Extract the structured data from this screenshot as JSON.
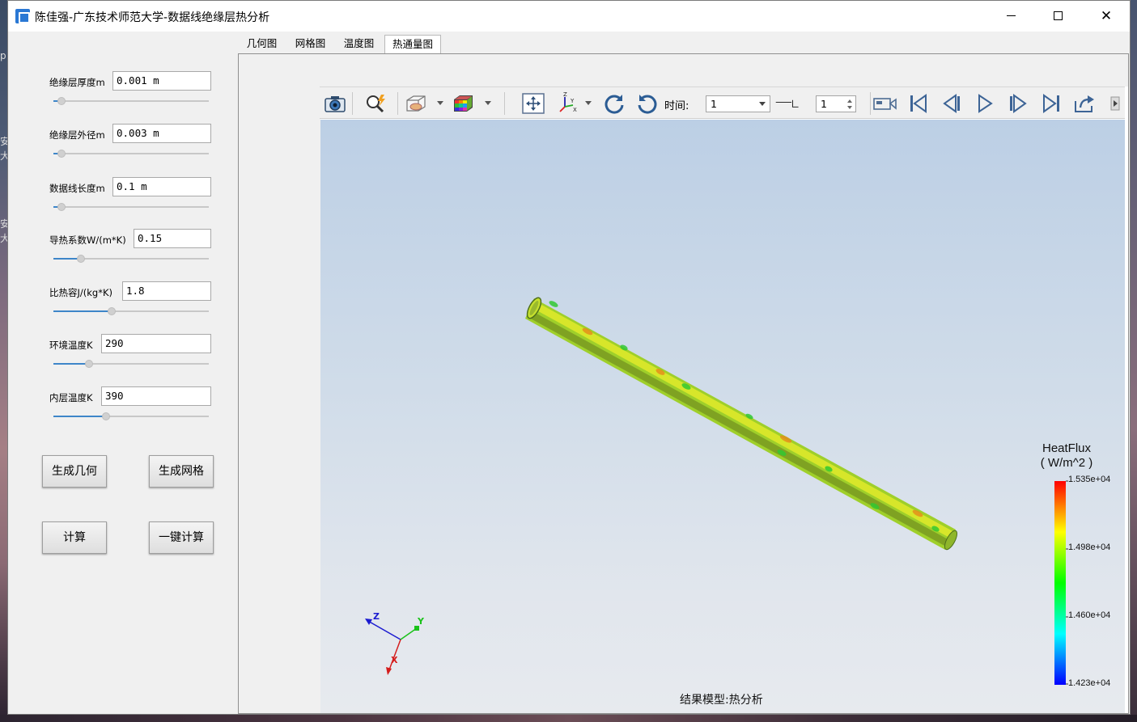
{
  "window": {
    "title": "陈佳强-广东技术师范大学-数据线绝缘层热分析"
  },
  "desktop_edge_chars": [
    "p",
    "安",
    "大",
    "安",
    "大"
  ],
  "params": [
    {
      "label": "绝缘层厚度m",
      "value": "0.001 m",
      "slider_fraction": 0.0
    },
    {
      "label": "绝缘层外径m",
      "value": "0.003 m",
      "slider_fraction": 0.0
    },
    {
      "label": "数据线长度m",
      "value": "0.1 m",
      "slider_fraction": 0.0
    },
    {
      "label": "导热系数W/(m*K)",
      "value": "0.15",
      "slider_fraction": 0.14
    },
    {
      "label": "比热容J/(kg*K)",
      "value": "1.8",
      "slider_fraction": 0.36
    },
    {
      "label": "环境温度K",
      "value": "290",
      "slider_fraction": 0.2
    },
    {
      "label": "内层温度K",
      "value": "390",
      "slider_fraction": 0.32
    }
  ],
  "buttons": {
    "gen_geometry": "生成几何",
    "gen_mesh": "生成网格",
    "compute": "计算",
    "one_click": "一键计算"
  },
  "tabs": [
    "几何图",
    "网格图",
    "温度图",
    "热通量图"
  ],
  "active_tab_index": 3,
  "toolbar": {
    "time_label": "时间:",
    "time_value": "1",
    "step_value": "1"
  },
  "result": {
    "model_label": "结果模型:热分析",
    "colorbar": {
      "title": "HeatFlux",
      "unit": "( W/m^2 )",
      "max_label": "1.535e+04",
      "ticks": [
        "1.535e+04",
        "1.498e+04",
        "1.460e+04",
        "1.423e+04"
      ],
      "colors": [
        "#ff0000",
        "#ffff00",
        "#00ff00",
        "#00ffff",
        "#0000ff"
      ]
    },
    "axes": {
      "x": "X",
      "y": "Y",
      "z": "Z"
    }
  },
  "icons": {
    "app": "app-icon",
    "screenshot": "camera-icon",
    "probe": "magnifier-probe-icon",
    "display_mode": "wireframe-box-icon",
    "color_map": "color-cube-icon",
    "fit": "fit-view-icon",
    "axes": "axes-triad-icon",
    "rotate_cw": "rotate-cw-icon",
    "rotate_ccw": "rotate-ccw-icon",
    "record": "video-record-icon",
    "first": "first-frame-icon",
    "prev": "prev-frame-icon",
    "play": "play-icon",
    "next": "next-frame-icon",
    "last": "last-frame-icon",
    "export": "export-icon"
  }
}
